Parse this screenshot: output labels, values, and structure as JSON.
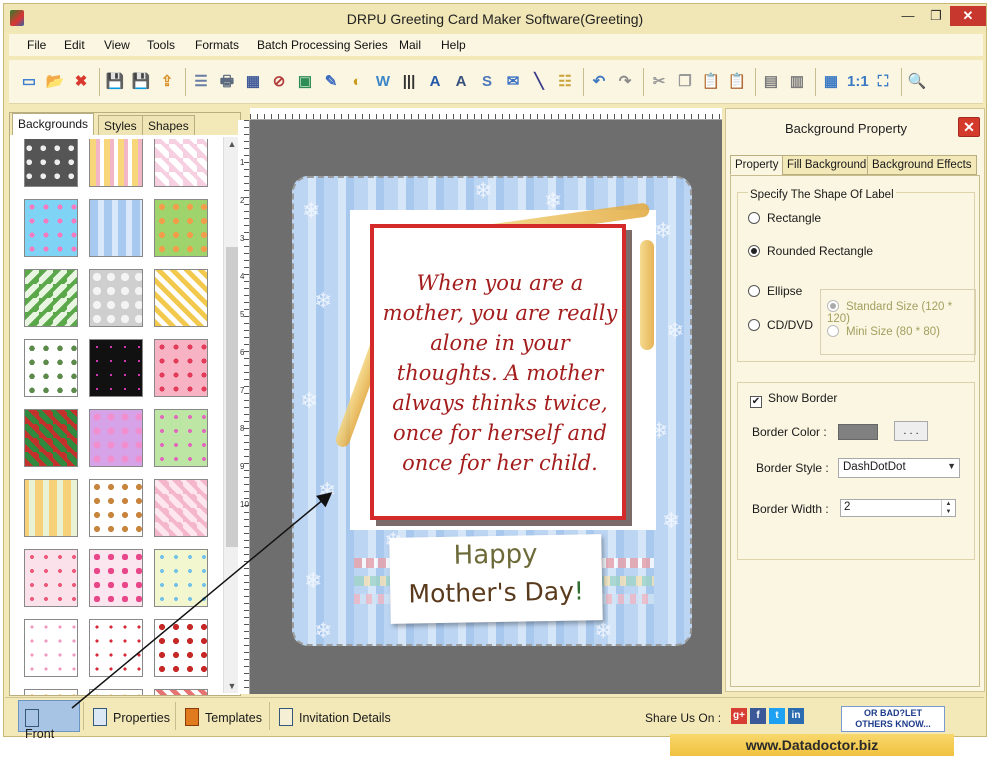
{
  "window": {
    "title": "DRPU Greeting Card Maker Software(Greeting)",
    "minimize_glyph": "—",
    "maximize_glyph": "❐",
    "close_glyph": "✕"
  },
  "menu": [
    "File",
    "Edit",
    "View",
    "Tools",
    "Formats",
    "Batch Processing Series",
    "Mail",
    "Help"
  ],
  "toolbar": {
    "icons": [
      "new-icon",
      "open-icon",
      "close-doc-icon",
      "save-icon",
      "save-as-icon",
      "export-icon",
      "properties-icon",
      "print-icon",
      "print-preview-icon",
      "delete-icon",
      "image-icon",
      "pen-icon",
      "shape-icon",
      "wordart-icon",
      "barcode-icon",
      "text-icon",
      "text-style-icon",
      "signature-icon",
      "email-icon",
      "line-icon",
      "database-icon",
      "undo-icon",
      "redo-icon",
      "cut-icon",
      "copy-icon",
      "paste-icon",
      "paste-special-icon",
      "bring-front-icon",
      "send-back-icon",
      "grid-icon",
      "actual-size-icon",
      "fit-icon",
      "zoom-icon"
    ]
  },
  "left_panel": {
    "tabs": [
      "Backgrounds",
      "Styles",
      "Shapes"
    ],
    "active_tab": "Backgrounds"
  },
  "ruler": {
    "vertical_numbers": [
      "1",
      "2",
      "3",
      "4",
      "5",
      "6",
      "7",
      "8",
      "9",
      "10"
    ]
  },
  "card": {
    "quote": "When you are a mother, you are really alone in your thoughts. A mother always thinks twice, once for herself and once for her child.",
    "greeting_line1": "Happy",
    "greeting_line2": "Mother's Day",
    "greeting_excl": "!"
  },
  "right_panel": {
    "title": "Background Property",
    "tabs": [
      "Property",
      "Fill Background",
      "Background Effects"
    ],
    "active_tab": "Property",
    "shape_group_label": "Specify The Shape Of Label",
    "shapes": [
      "Rectangle",
      "Rounded Rectangle",
      "Ellipse",
      "CD/DVD"
    ],
    "selected_shape": "Rounded Rectangle",
    "sizes": [
      "Standard Size (120 * 120)",
      "Mini Size (80 * 80)"
    ],
    "show_border_label": "Show Border",
    "show_border_checked": true,
    "border_color_label": "Border Color :",
    "border_color": "#808080",
    "color_button": ". . .",
    "border_style_label": "Border Style :",
    "border_style_value": "DashDotDot",
    "border_width_label": "Border Width :",
    "border_width_value": "2"
  },
  "bottom_bar": {
    "tabs": [
      "Front",
      "Properties",
      "Templates",
      "Invitation Details"
    ],
    "active_tab": "Front",
    "share_label": "Share Us On :",
    "social": [
      "g+",
      "f",
      "t",
      "in"
    ],
    "feedback_line1": "OR BAD?LET",
    "feedback_line2": "OTHERS KNOW..."
  },
  "footer": {
    "url": "www.Datadoctor.biz"
  },
  "colors": {
    "app_bg": "#f3e8b8",
    "accent_blue": "#a7c4e4",
    "close_red": "#c7372d",
    "quote_red": "#a41d1d"
  }
}
